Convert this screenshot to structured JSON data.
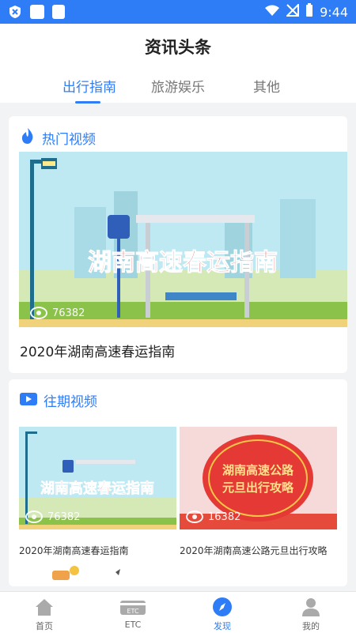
{
  "status_bar": {
    "time": "9:44"
  },
  "header": {
    "title": "资讯头条"
  },
  "tabs": [
    {
      "label": "出行指南",
      "active": true
    },
    {
      "label": "旅游娱乐",
      "active": false
    },
    {
      "label": "其他",
      "active": false
    }
  ],
  "hot_section": {
    "title": "热门视频",
    "video": {
      "thumb_text": "湖南高速春运指南",
      "views": "76382",
      "title": "2020年湖南高速春运指南"
    }
  },
  "past_section": {
    "title": "往期视频",
    "videos": [
      {
        "thumb_text": "湖南高速春运指南",
        "views": "76382",
        "title": "2020年湖南高速春运指南"
      },
      {
        "thumb_text_line1": "湖南高速公路",
        "thumb_text_line2": "元旦出行攻略",
        "views": "16382",
        "title": "2020年湖南高速公路元旦出行攻略"
      }
    ]
  },
  "bottom_nav": [
    {
      "label": "首页",
      "icon": "home-icon",
      "active": false
    },
    {
      "label": "ETC",
      "icon": "etc-card-icon",
      "active": false
    },
    {
      "label": "发现",
      "icon": "compass-icon",
      "active": true
    },
    {
      "label": "我的",
      "icon": "user-icon",
      "active": false
    }
  ],
  "colors": {
    "accent": "#2f7df6",
    "banner_red": "#e0403a"
  }
}
